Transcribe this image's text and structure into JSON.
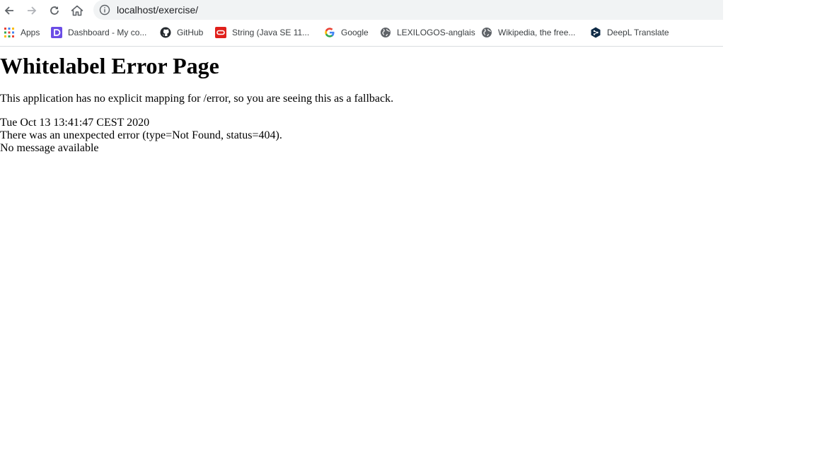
{
  "toolbar": {
    "url": "localhost/exercise/",
    "back_icon": "arrow-left-icon",
    "forward_icon": "arrow-right-icon",
    "reload_icon": "reload-icon",
    "home_icon": "home-icon",
    "info_icon": "info-icon"
  },
  "bookmarks": [
    {
      "label": "Apps",
      "icon": "apps-grid-icon"
    },
    {
      "label": "Dashboard - My co...",
      "icon": "dashboard-icon"
    },
    {
      "label": "GitHub",
      "icon": "github-icon"
    },
    {
      "label": "String (Java SE 11...",
      "icon": "oracle-icon"
    },
    {
      "label": "Google",
      "icon": "google-icon"
    },
    {
      "label": "LEXILOGOS-anglais",
      "icon": "globe-icon"
    },
    {
      "label": "Wikipedia, the free...",
      "icon": "globe-icon"
    },
    {
      "label": "DeepL Translate",
      "icon": "deepl-icon"
    }
  ],
  "page": {
    "title": "Whitelabel Error Page",
    "description": "This application has no explicit mapping for /error, so you are seeing this as a fallback.",
    "timestamp": "Tue Oct 13 13:41:47 CEST 2020",
    "error_line": "There was an unexpected error (type=Not Found, status=404).",
    "message": "No message available"
  },
  "colors": {
    "omnibox_bg": "#f1f3f4",
    "oracle_red": "#e0201b",
    "dashboard_purple": "#6b4de6",
    "deepl_navy": "#0f2b46"
  }
}
